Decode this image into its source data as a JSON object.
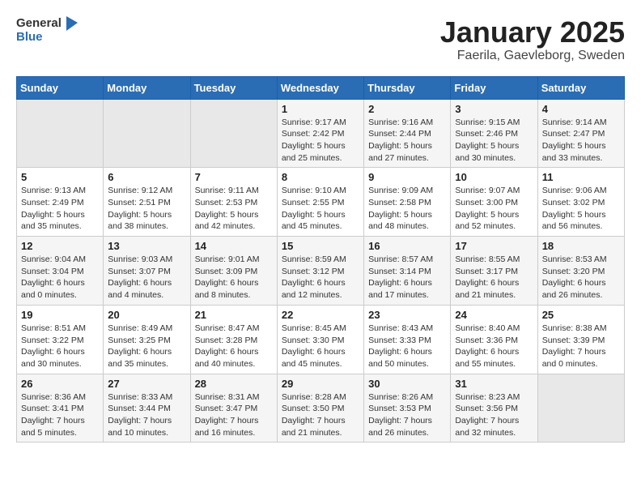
{
  "header": {
    "logo_general": "General",
    "logo_blue": "Blue",
    "month": "January 2025",
    "location": "Faerila, Gaevleborg, Sweden"
  },
  "calendar": {
    "days_of_week": [
      "Sunday",
      "Monday",
      "Tuesday",
      "Wednesday",
      "Thursday",
      "Friday",
      "Saturday"
    ],
    "weeks": [
      [
        {
          "day": "",
          "info": ""
        },
        {
          "day": "",
          "info": ""
        },
        {
          "day": "",
          "info": ""
        },
        {
          "day": "1",
          "info": "Sunrise: 9:17 AM\nSunset: 2:42 PM\nDaylight: 5 hours and 25 minutes."
        },
        {
          "day": "2",
          "info": "Sunrise: 9:16 AM\nSunset: 2:44 PM\nDaylight: 5 hours and 27 minutes."
        },
        {
          "day": "3",
          "info": "Sunrise: 9:15 AM\nSunset: 2:46 PM\nDaylight: 5 hours and 30 minutes."
        },
        {
          "day": "4",
          "info": "Sunrise: 9:14 AM\nSunset: 2:47 PM\nDaylight: 5 hours and 33 minutes."
        }
      ],
      [
        {
          "day": "5",
          "info": "Sunrise: 9:13 AM\nSunset: 2:49 PM\nDaylight: 5 hours and 35 minutes."
        },
        {
          "day": "6",
          "info": "Sunrise: 9:12 AM\nSunset: 2:51 PM\nDaylight: 5 hours and 38 minutes."
        },
        {
          "day": "7",
          "info": "Sunrise: 9:11 AM\nSunset: 2:53 PM\nDaylight: 5 hours and 42 minutes."
        },
        {
          "day": "8",
          "info": "Sunrise: 9:10 AM\nSunset: 2:55 PM\nDaylight: 5 hours and 45 minutes."
        },
        {
          "day": "9",
          "info": "Sunrise: 9:09 AM\nSunset: 2:58 PM\nDaylight: 5 hours and 48 minutes."
        },
        {
          "day": "10",
          "info": "Sunrise: 9:07 AM\nSunset: 3:00 PM\nDaylight: 5 hours and 52 minutes."
        },
        {
          "day": "11",
          "info": "Sunrise: 9:06 AM\nSunset: 3:02 PM\nDaylight: 5 hours and 56 minutes."
        }
      ],
      [
        {
          "day": "12",
          "info": "Sunrise: 9:04 AM\nSunset: 3:04 PM\nDaylight: 6 hours and 0 minutes."
        },
        {
          "day": "13",
          "info": "Sunrise: 9:03 AM\nSunset: 3:07 PM\nDaylight: 6 hours and 4 minutes."
        },
        {
          "day": "14",
          "info": "Sunrise: 9:01 AM\nSunset: 3:09 PM\nDaylight: 6 hours and 8 minutes."
        },
        {
          "day": "15",
          "info": "Sunrise: 8:59 AM\nSunset: 3:12 PM\nDaylight: 6 hours and 12 minutes."
        },
        {
          "day": "16",
          "info": "Sunrise: 8:57 AM\nSunset: 3:14 PM\nDaylight: 6 hours and 17 minutes."
        },
        {
          "day": "17",
          "info": "Sunrise: 8:55 AM\nSunset: 3:17 PM\nDaylight: 6 hours and 21 minutes."
        },
        {
          "day": "18",
          "info": "Sunrise: 8:53 AM\nSunset: 3:20 PM\nDaylight: 6 hours and 26 minutes."
        }
      ],
      [
        {
          "day": "19",
          "info": "Sunrise: 8:51 AM\nSunset: 3:22 PM\nDaylight: 6 hours and 30 minutes."
        },
        {
          "day": "20",
          "info": "Sunrise: 8:49 AM\nSunset: 3:25 PM\nDaylight: 6 hours and 35 minutes."
        },
        {
          "day": "21",
          "info": "Sunrise: 8:47 AM\nSunset: 3:28 PM\nDaylight: 6 hours and 40 minutes."
        },
        {
          "day": "22",
          "info": "Sunrise: 8:45 AM\nSunset: 3:30 PM\nDaylight: 6 hours and 45 minutes."
        },
        {
          "day": "23",
          "info": "Sunrise: 8:43 AM\nSunset: 3:33 PM\nDaylight: 6 hours and 50 minutes."
        },
        {
          "day": "24",
          "info": "Sunrise: 8:40 AM\nSunset: 3:36 PM\nDaylight: 6 hours and 55 minutes."
        },
        {
          "day": "25",
          "info": "Sunrise: 8:38 AM\nSunset: 3:39 PM\nDaylight: 7 hours and 0 minutes."
        }
      ],
      [
        {
          "day": "26",
          "info": "Sunrise: 8:36 AM\nSunset: 3:41 PM\nDaylight: 7 hours and 5 minutes."
        },
        {
          "day": "27",
          "info": "Sunrise: 8:33 AM\nSunset: 3:44 PM\nDaylight: 7 hours and 10 minutes."
        },
        {
          "day": "28",
          "info": "Sunrise: 8:31 AM\nSunset: 3:47 PM\nDaylight: 7 hours and 16 minutes."
        },
        {
          "day": "29",
          "info": "Sunrise: 8:28 AM\nSunset: 3:50 PM\nDaylight: 7 hours and 21 minutes."
        },
        {
          "day": "30",
          "info": "Sunrise: 8:26 AM\nSunset: 3:53 PM\nDaylight: 7 hours and 26 minutes."
        },
        {
          "day": "31",
          "info": "Sunrise: 8:23 AM\nSunset: 3:56 PM\nDaylight: 7 hours and 32 minutes."
        },
        {
          "day": "",
          "info": ""
        }
      ]
    ]
  }
}
